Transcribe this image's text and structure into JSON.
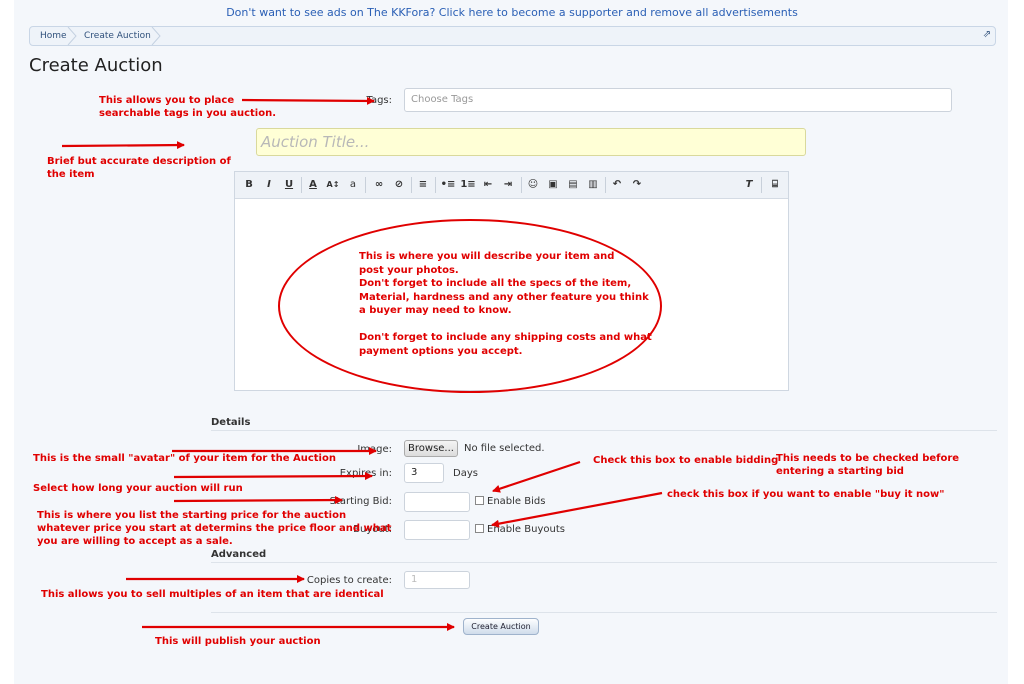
{
  "ad_link": "Don't want to see ads on The KKFora? Click here to become a supporter and remove all advertisements",
  "breadcrumb": {
    "home": "Home",
    "current": "Create Auction"
  },
  "page_title": "Create Auction",
  "form": {
    "tags_label": "Tags:",
    "tags_placeholder": "Choose Tags",
    "title_placeholder": "Auction Title...",
    "details_heading": "Details",
    "image_label": "Image:",
    "browse_label": "Browse...",
    "no_file_text": "No file selected.",
    "expires_label": "Expires in:",
    "expires_value": "3",
    "expires_unit": "Days",
    "starting_bid_label": "Starting Bid:",
    "enable_bids_label": "Enable Bids",
    "buyout_label": "Buyout:",
    "enable_buyouts_label": "Enable Buyouts",
    "advanced_heading": "Advanced",
    "copies_label": "Copies to create:",
    "copies_placeholder": "1",
    "submit_label": "Create Auction"
  },
  "toolbar_icons": [
    "bold-icon",
    "italic-icon",
    "underline-icon",
    "font-color-icon",
    "font-size-icon",
    "font-family-icon",
    "link-icon",
    "unlink-icon",
    "align-icon",
    "bullet-list-icon",
    "number-list-icon",
    "outdent-icon",
    "indent-icon",
    "smilie-icon",
    "image-icon",
    "media-icon",
    "quote-icon",
    "undo-icon",
    "redo-icon",
    "remove-format-icon",
    "source-toggle-icon"
  ],
  "annotations": {
    "tags": "This allows you to place\nsearchable tags in you auction.",
    "title": "Brief but accurate description of\nthe item",
    "editor": "This is where you will describe your item and\npost your photos.\nDon't forget to include all the specs of the item,\nMaterial, hardness and any other feature you think\na buyer may need to know.\n\nDon't forget to include any shipping costs and what\npayment options you accept.",
    "image": "This is the small \"avatar\" of your item for the Auction",
    "expires": "Select how long your auction will run",
    "starting_bid": "This is where you list the starting price for the auction\nwhatever price you start at determins the price floor and what\nyou are willing to accept as a sale.",
    "enable_bids": "Check this box to enable bidding",
    "enable_bids_note": "This needs to be checked before\nentering a starting bid",
    "enable_buyouts": "check this box if you want to enable \"buy it now\"",
    "copies": "This allows you to sell multiples of an item that are identical",
    "submit": "This will publish your auction"
  },
  "colors": {
    "annotation": "#e00000",
    "link": "#2a5fb5",
    "title_field_bg": "#ffffd6"
  }
}
